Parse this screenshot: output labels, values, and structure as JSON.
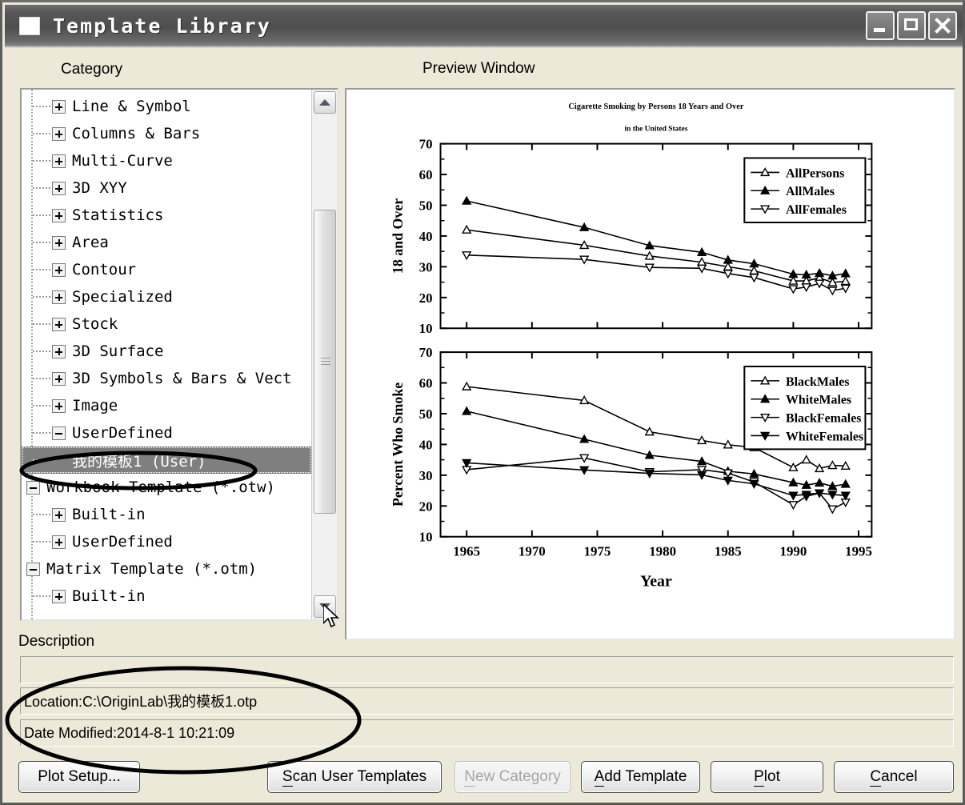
{
  "window": {
    "title": "Template Library",
    "icon": "app-window-icon",
    "buttons": {
      "minimize": "minimize-icon",
      "maximize": "maximize-icon",
      "close": "close-icon"
    }
  },
  "labels": {
    "category": "Category",
    "preview": "Preview Window",
    "description": "Description"
  },
  "tree": {
    "items": [
      {
        "label": "Line & Symbol",
        "state": "plus",
        "level": 1,
        "selected": false
      },
      {
        "label": "Columns & Bars",
        "state": "plus",
        "level": 1,
        "selected": false
      },
      {
        "label": "Multi-Curve",
        "state": "plus",
        "level": 1,
        "selected": false
      },
      {
        "label": "3D XYY",
        "state": "plus",
        "level": 1,
        "selected": false
      },
      {
        "label": "Statistics",
        "state": "plus",
        "level": 1,
        "selected": false
      },
      {
        "label": "Area",
        "state": "plus",
        "level": 1,
        "selected": false
      },
      {
        "label": "Contour",
        "state": "plus",
        "level": 1,
        "selected": false
      },
      {
        "label": "Specialized",
        "state": "plus",
        "level": 1,
        "selected": false
      },
      {
        "label": "Stock",
        "state": "plus",
        "level": 1,
        "selected": false
      },
      {
        "label": "3D Surface",
        "state": "plus",
        "level": 1,
        "selected": false
      },
      {
        "label": "3D Symbols & Bars & Vect",
        "state": "plus",
        "level": 1,
        "selected": false
      },
      {
        "label": "Image",
        "state": "plus",
        "level": 1,
        "selected": false
      },
      {
        "label": "UserDefined",
        "state": "minus",
        "level": 1,
        "selected": false
      },
      {
        "label": "我的模板1 (User)",
        "state": "none",
        "level": 2,
        "selected": true
      },
      {
        "label": "Workbook Template (*.otw)",
        "state": "minus",
        "level": 0,
        "selected": false
      },
      {
        "label": "Built-in",
        "state": "plus",
        "level": 1,
        "selected": false
      },
      {
        "label": "UserDefined",
        "state": "plus",
        "level": 1,
        "selected": false
      },
      {
        "label": "Matrix Template (*.otm)",
        "state": "minus",
        "level": 0,
        "selected": false
      },
      {
        "label": "Built-in",
        "state": "plus",
        "level": 1,
        "selected": false
      }
    ],
    "scrollbar": {
      "up": "scroll-up-icon",
      "down": "scroll-down-icon"
    }
  },
  "description": {
    "empty": "",
    "location": "Location:C:\\OriginLab\\我的模板1.otp",
    "date_modified": "Date Modified:2014-8-1 10:21:09"
  },
  "footer": {
    "plot_setup": "Plot Setup...",
    "scan_user_templates": "Scan User Templates",
    "scan_accel": "S",
    "scan_rest": "can User Templates",
    "new_category": "New Category",
    "new_accel": "N",
    "new_rest": "ew Category",
    "add_template": "Add Template",
    "add_accel": "A",
    "add_rest": "dd Template",
    "plot": "Plot",
    "plot_accel": "P",
    "plot_rest": "lot",
    "cancel": "Cancel",
    "cancel_accel": "C",
    "cancel_rest": "ancel"
  },
  "chart_data": [
    {
      "type": "line",
      "title": "Cigarette Smoking by Persons 18 Years and Over",
      "subtitle": "in the United States",
      "xlabel": "",
      "ylabel": "18 and Over",
      "ylim": [
        10,
        70
      ],
      "yticks": [
        10,
        20,
        30,
        40,
        50,
        60,
        70
      ],
      "xlim": [
        1963,
        1996
      ],
      "xticks": [
        1965,
        1970,
        1975,
        1980,
        1985,
        1990,
        1995
      ],
      "grid": false,
      "legend_position": "top-right",
      "x": [
        1965,
        1974,
        1979,
        1983,
        1985,
        1987,
        1990,
        1991,
        1992,
        1993,
        1994
      ],
      "series": [
        {
          "name": "AllPersons",
          "marker": "triangle-up-open",
          "values": [
            42.0,
            37.0,
            33.5,
            31.5,
            30.0,
            28.7,
            25.4,
            25.4,
            26.4,
            24.9,
            25.3
          ]
        },
        {
          "name": "AllMales",
          "marker": "triangle-up-filled",
          "values": [
            51.4,
            42.8,
            36.9,
            34.7,
            32.2,
            31.0,
            27.6,
            27.4,
            27.9,
            27.1,
            27.8
          ]
        },
        {
          "name": "AllFemales",
          "marker": "triangle-down-open",
          "values": [
            33.8,
            32.4,
            29.8,
            29.5,
            27.8,
            26.5,
            22.8,
            23.4,
            24.6,
            22.3,
            23.0
          ]
        }
      ]
    },
    {
      "type": "line",
      "title": "",
      "subtitle": "",
      "xlabel": "Year",
      "ylabel": "Percent Who Smoke",
      "ylim": [
        10,
        70
      ],
      "yticks": [
        10,
        20,
        30,
        40,
        50,
        60,
        70
      ],
      "xlim": [
        1963,
        1996
      ],
      "xticks": [
        1965,
        1970,
        1975,
        1980,
        1985,
        1990,
        1995
      ],
      "grid": false,
      "legend_position": "top-right",
      "x": [
        1965,
        1974,
        1979,
        1983,
        1985,
        1987,
        1990,
        1991,
        1992,
        1993,
        1994
      ],
      "series": [
        {
          "name": "BlackMales",
          "marker": "triangle-up-open",
          "values": [
            58.8,
            54.3,
            44.1,
            41.3,
            39.9,
            39.0,
            32.5,
            35.0,
            32.2,
            33.2,
            33.0
          ]
        },
        {
          "name": "WhiteMales",
          "marker": "triangle-up-filled",
          "values": [
            50.8,
            41.7,
            36.5,
            34.5,
            31.3,
            30.4,
            27.6,
            26.8,
            27.5,
            26.4,
            27.1
          ]
        },
        {
          "name": "BlackFemales",
          "marker": "triangle-down-open",
          "values": [
            31.8,
            35.6,
            31.1,
            31.8,
            30.7,
            27.8,
            20.4,
            23.1,
            24.2,
            19.0,
            21.2
          ]
        },
        {
          "name": "WhiteFemales",
          "marker": "triangle-down-filled",
          "values": [
            34.0,
            31.7,
            30.6,
            30.1,
            28.3,
            27.2,
            23.4,
            23.7,
            24.2,
            23.7,
            23.4
          ]
        }
      ]
    }
  ]
}
